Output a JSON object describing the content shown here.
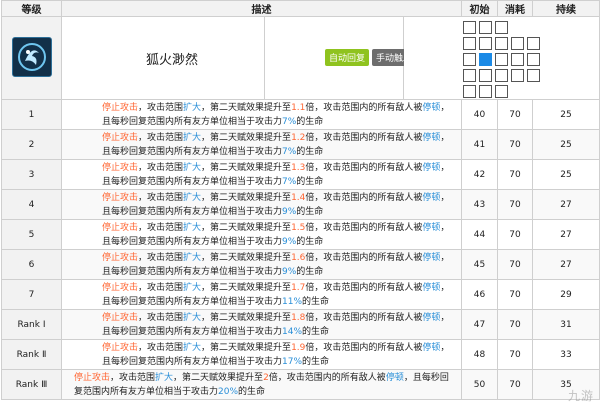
{
  "skill": {
    "name": "狐火渺然",
    "icon": "fox-fire-skill-icon",
    "tags": [
      {
        "label": "自动回复",
        "color": "#8fc31f"
      },
      {
        "label": "手动触发",
        "color": "#6d6d6d"
      }
    ],
    "range_grid": [
      [
        1,
        1,
        1,
        0,
        0
      ],
      [
        1,
        1,
        1,
        1,
        1
      ],
      [
        1,
        2,
        1,
        1,
        1
      ],
      [
        1,
        1,
        1,
        1,
        1
      ],
      [
        1,
        1,
        1,
        0,
        0
      ]
    ]
  },
  "columns": {
    "level": "等级",
    "desc": "描述",
    "initial": "初始",
    "cost": "消耗",
    "duration": "持续"
  },
  "rows": [
    {
      "level": "1",
      "p1": "停止攻击",
      "p2": "，攻击范围",
      "p3": "扩大",
      "p4": "，第二天赋效果提升至",
      "p5": "1.1",
      "p6": "倍，攻击范围内的所有敌人被",
      "p7": "停顿",
      "p8": "，且每秒回复范围内所有友方单位相当于攻击力",
      "p9": "7%",
      "p10": "的生命",
      "initial": "40",
      "cost": "70",
      "duration": "25"
    },
    {
      "level": "2",
      "p1": "停止攻击",
      "p2": "，攻击范围",
      "p3": "扩大",
      "p4": "，第二天赋效果提升至",
      "p5": "1.2",
      "p6": "倍，攻击范围内的所有敌人被",
      "p7": "停顿",
      "p8": "，且每秒回复范围内所有友方单位相当于攻击力",
      "p9": "7%",
      "p10": "的生命",
      "initial": "41",
      "cost": "70",
      "duration": "25"
    },
    {
      "level": "3",
      "p1": "停止攻击",
      "p2": "，攻击范围",
      "p3": "扩大",
      "p4": "，第二天赋效果提升至",
      "p5": "1.3",
      "p6": "倍，攻击范围内的所有敌人被",
      "p7": "停顿",
      "p8": "，且每秒回复范围内所有友方单位相当于攻击力",
      "p9": "7%",
      "p10": "的生命",
      "initial": "42",
      "cost": "70",
      "duration": "25"
    },
    {
      "level": "4",
      "p1": "停止攻击",
      "p2": "，攻击范围",
      "p3": "扩大",
      "p4": "，第二天赋效果提升至",
      "p5": "1.4",
      "p6": "倍，攻击范围内的所有敌人被",
      "p7": "停顿",
      "p8": "，且每秒回复范围内所有友方单位相当于攻击力",
      "p9": "9%",
      "p10": "的生命",
      "initial": "43",
      "cost": "70",
      "duration": "27"
    },
    {
      "level": "5",
      "p1": "停止攻击",
      "p2": "，攻击范围",
      "p3": "扩大",
      "p4": "，第二天赋效果提升至",
      "p5": "1.5",
      "p6": "倍，攻击范围内的所有敌人被",
      "p7": "停顿",
      "p8": "，且每秒回复范围内所有友方单位相当于攻击力",
      "p9": "9%",
      "p10": "的生命",
      "initial": "44",
      "cost": "70",
      "duration": "27"
    },
    {
      "level": "6",
      "p1": "停止攻击",
      "p2": "，攻击范围",
      "p3": "扩大",
      "p4": "，第二天赋效果提升至",
      "p5": "1.6",
      "p6": "倍，攻击范围内的所有敌人被",
      "p7": "停顿",
      "p8": "，且每秒回复范围内所有友方单位相当于攻击力",
      "p9": "9%",
      "p10": "的生命",
      "initial": "45",
      "cost": "70",
      "duration": "27"
    },
    {
      "level": "7",
      "p1": "停止攻击",
      "p2": "，攻击范围",
      "p3": "扩大",
      "p4": "，第二天赋效果提升至",
      "p5": "1.7",
      "p6": "倍，攻击范围内的所有敌人被",
      "p7": "停顿",
      "p8": "，且每秒回复范围内所有友方单位相当于攻击力",
      "p9": "11%",
      "p10": "的生命",
      "initial": "46",
      "cost": "70",
      "duration": "29"
    },
    {
      "level": "Rank Ⅰ",
      "p1": "停止攻击",
      "p2": "，攻击范围",
      "p3": "扩大",
      "p4": "，第二天赋效果提升至",
      "p5": "1.8",
      "p6": "倍，攻击范围内的所有敌人被",
      "p7": "停顿",
      "p8": "，且每秒回复范围内所有友方单位相当于攻击力",
      "p9": "14%",
      "p10": "的生命",
      "initial": "47",
      "cost": "70",
      "duration": "31"
    },
    {
      "level": "Rank Ⅱ",
      "p1": "停止攻击",
      "p2": "，攻击范围",
      "p3": "扩大",
      "p4": "，第二天赋效果提升至",
      "p5": "1.9",
      "p6": "倍，攻击范围内的所有敌人被",
      "p7": "停顿",
      "p8": "，且每秒回复范围内所有友方单位相当于攻击力",
      "p9": "17%",
      "p10": "的生命",
      "initial": "48",
      "cost": "70",
      "duration": "33"
    },
    {
      "level": "Rank Ⅲ",
      "p1": "停止攻击",
      "p2": "，攻击范围",
      "p3": "扩大",
      "p4": "，第二天赋效果提升至",
      "p5": "2",
      "p6": "倍，攻击范围内的所有敌人被",
      "p7": "停顿",
      "p8": "，且每秒回复范围内所有友方单位相当于攻击力",
      "p9": "20%",
      "p10": "的生命",
      "initial": "50",
      "cost": "70",
      "duration": "35"
    }
  ],
  "colors": {
    "highlight": "#ff6633",
    "keyword": "#2a8fd8",
    "range_active": "#1b8ae6"
  },
  "watermark": "九游"
}
